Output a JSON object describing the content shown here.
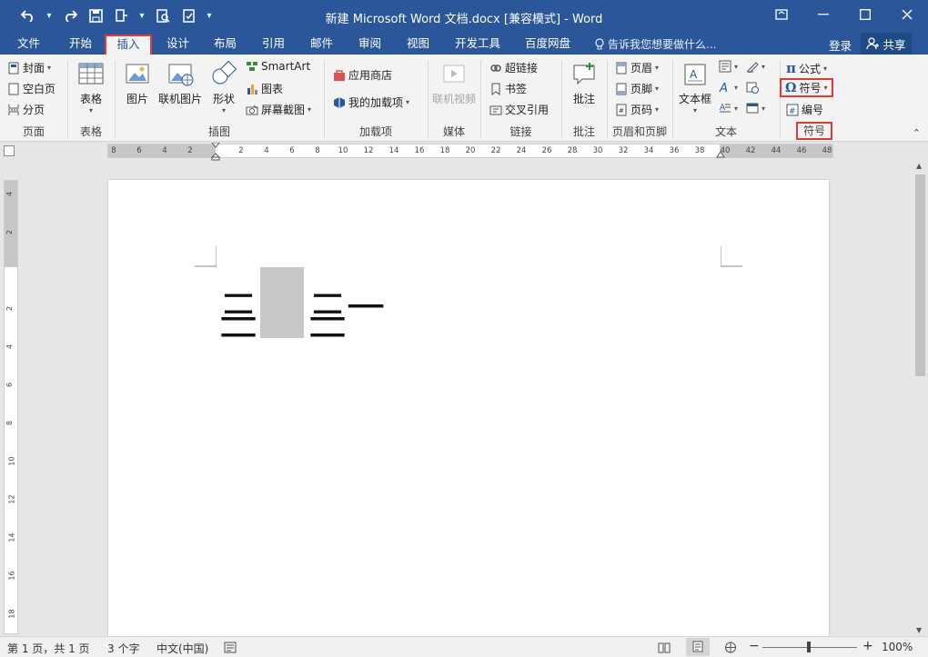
{
  "titlebar": {
    "title": "新建 Microsoft Word 文档.docx [兼容模式] - Word",
    "qat_icons": [
      "undo-icon",
      "redo-icon",
      "save-icon",
      "touch-mode-icon",
      "print-preview-icon",
      "new-doc-icon",
      "customize-icon"
    ],
    "window_controls": [
      "ribbon-display-icon",
      "minimize-icon",
      "maximize-icon",
      "close-icon"
    ]
  },
  "tabs": {
    "file": "文件",
    "home": "开始",
    "insert": "插入",
    "design": "设计",
    "layout": "布局",
    "references": "引用",
    "mailings": "邮件",
    "review": "审阅",
    "view": "视图",
    "developer": "开发工具",
    "baidu": "百度网盘",
    "tell_me": "告诉我您想要做什么...",
    "login": "登录",
    "share": "共享"
  },
  "ribbon": {
    "pages": {
      "cover": "封面",
      "blank": "空白页",
      "break": "分页",
      "group": "页面"
    },
    "tables": {
      "table": "表格",
      "group": "表格"
    },
    "illustrations": {
      "picture": "图片",
      "online_picture": "联机图片",
      "shapes": "形状",
      "smartart": "SmartArt",
      "chart": "图表",
      "screenshot": "屏幕截图",
      "group": "插图"
    },
    "addins": {
      "store": "应用商店",
      "my_addins": "我的加载项",
      "group": "加载项"
    },
    "media": {
      "online_video": "联机视频",
      "group": "媒体"
    },
    "links": {
      "hyperlink": "超链接",
      "bookmark": "书签",
      "crossref": "交叉引用",
      "group": "链接"
    },
    "comments": {
      "comment": "批注",
      "group": "批注"
    },
    "header_footer": {
      "header": "页眉",
      "footer": "页脚",
      "page_number": "页码",
      "group": "页眉和页脚"
    },
    "text": {
      "textbox": "文本框",
      "group": "文本"
    },
    "symbols": {
      "equation": "公式",
      "symbol": "符号",
      "numbering": "编号",
      "group": "符号"
    }
  },
  "ruler": {
    "ticks": [
      "8",
      "6",
      "4",
      "2",
      "",
      "2",
      "4",
      "6",
      "8",
      "10",
      "12",
      "14",
      "16",
      "18",
      "20",
      "22",
      "24",
      "26",
      "28",
      "30",
      "32",
      "34",
      "36",
      "38",
      "40",
      "42",
      "44",
      "46",
      "48"
    ],
    "vticks": [
      "4",
      "2",
      "",
      "2",
      "4",
      "6",
      "8",
      "10",
      "12",
      "14",
      "16",
      "18"
    ]
  },
  "document": {
    "line1_left": "二",
    "line1_right": "二一",
    "line2_left": "二",
    "line2_right": "二"
  },
  "statusbar": {
    "page": "第 1 页，共 1 页",
    "words": "3 个字",
    "language": "中文(中国)",
    "zoom": "100%"
  },
  "colors": {
    "accent": "#2b579a",
    "highlight": "#e53935"
  }
}
